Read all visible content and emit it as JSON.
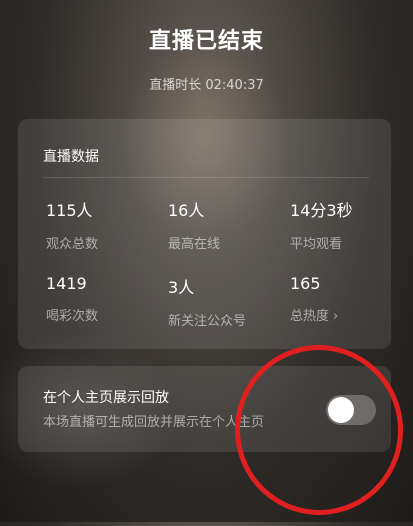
{
  "header": {
    "title": "直播已结束",
    "duration": "直播时长 02:40:37"
  },
  "stats_card": {
    "title": "直播数据",
    "items": [
      {
        "value": "115人",
        "label": "观众总数"
      },
      {
        "value": "16人",
        "label": "最高在线"
      },
      {
        "value": "14分3秒",
        "label": "平均观看"
      },
      {
        "value": "1419",
        "label": "喝彩次数"
      },
      {
        "value": "3人",
        "label": "新关注公众号"
      },
      {
        "value": "165",
        "label": "总热度",
        "icon": "chevron-right-icon"
      }
    ]
  },
  "replay": {
    "title": "在个人主页展示回放",
    "subtitle": "本场直播可生成回放并展示在个人主页",
    "toggle_on": false
  },
  "colors": {
    "annotation_circle": "#e0201f"
  }
}
